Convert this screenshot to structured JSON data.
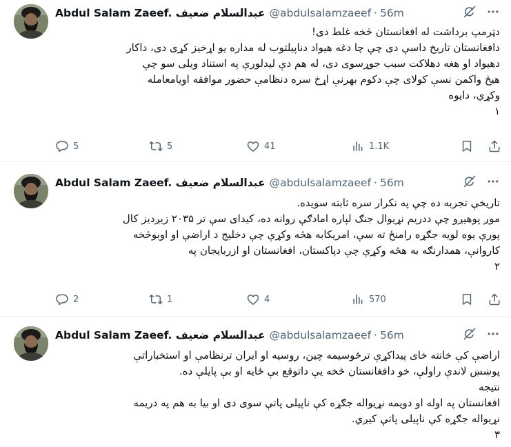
{
  "tweets": [
    {
      "name": "Abdul Salam Zaeef. عبدالسلام ضعيف",
      "handle": "@abdulsalamzaeef",
      "time": "56m",
      "lines": [
        "دټرمپ برداشت له افغانستان څخه غلط دی!",
        "دافغانستان تاریخ داسې دی چې چا دغه هیواد دناپیلتوب له مداره یو اړخیز کړی دی، داکار",
        "دهیواد او هغه دهلاکت سبب جوړسوی دی، له هم دې لیدلورې په استناد ویلی سو چې",
        "هیڅ واکمن نسې کولای چې دکوم بهرنې اړخ سره دنظامې حضور موافقه اویامعامله",
        "وکړي، دایوه",
        "۱"
      ],
      "stats": {
        "replies": "5",
        "reposts": "5",
        "likes": "41",
        "views": "1.1K"
      }
    },
    {
      "name": "Abdul Salam Zaeef. عبدالسلام ضعيف",
      "handle": "@abdulsalamzaeef",
      "time": "56m",
      "lines": [
        "تاریخې تجربه ده چې په تکرار سره ثابته سویده.",
        "موږ پوهیږو چې ددریم نړیوال جنګ لپاره امادګې روانه ده، کیدای سې تر ۲۰۳۵ زیږدیز کال",
        "پورې یوه لویه جګړه رامنځ ته سې، امریکابه هڅه وکړې چې دخلیج د اراضې او اوبوڅخه",
        "کاروانې، همدارنګه به هڅه وکړې چې دپاکستان، افغانستان او ازربایجان په",
        "۲"
      ],
      "stats": {
        "replies": "2",
        "reposts": "1",
        "likes": "4",
        "views": "570"
      }
    },
    {
      "name": "Abdul Salam Zaeef. عبدالسلام ضعيف",
      "handle": "@abdulsalamzaeef",
      "time": "56m",
      "lines": [
        "اراضې کې خانته خای پیداکړې ترڅوسیمه چین، روسیه او ایران ترنظامې او استخباراتې",
        "پوښښ لاندې راولې، خو دافغانستان څخه یې داتوقع بې ځایه او بې پایلې ده.",
        "نتیجه",
        "افغانستان په اوله او دویمه نړیواله جګړه کې ناپیلی پاتې سوی دی او بیا به هم په دریمه",
        "نړیواله جګړه کې ناپیلی پاتې کیږي.",
        "۳"
      ]
    }
  ],
  "icons": {
    "grok": "grok-icon",
    "more": "more-icon",
    "reply": "reply-icon",
    "repost": "repost-icon",
    "like": "like-icon",
    "views": "views-icon",
    "bookmark": "bookmark-icon",
    "share": "share-icon"
  },
  "colors": {
    "text": "#0f1419",
    "secondary": "#536471",
    "divider": "#eff3f4"
  }
}
